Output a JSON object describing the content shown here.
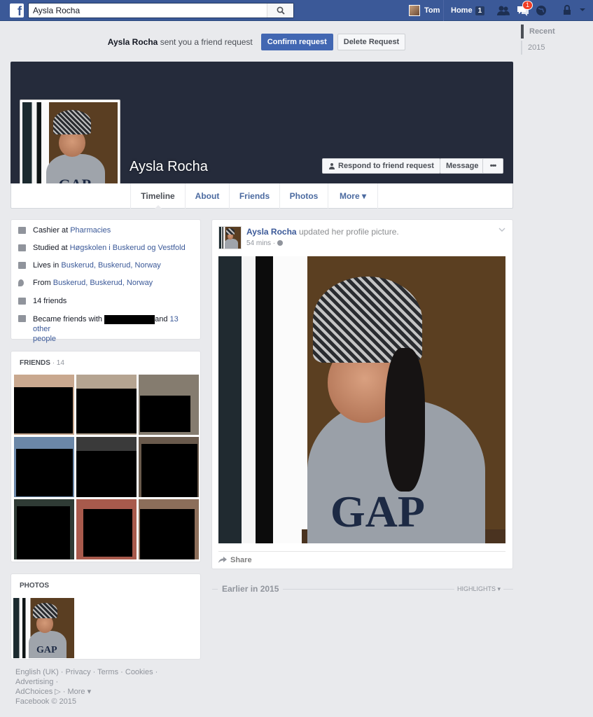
{
  "topbar": {
    "search_value": "Aysla Rocha",
    "user_name": "Tom",
    "home_label": "Home",
    "home_count": "1",
    "messages_badge": "1"
  },
  "friend_request": {
    "name": "Aysla Rocha",
    "text": "sent you a friend request",
    "confirm_label": "Confirm request",
    "delete_label": "Delete Request"
  },
  "profile": {
    "name": "Aysla Rocha",
    "respond_label": "Respond to friend request",
    "message_label": "Message",
    "more_dots": "•••",
    "gap_text": "GAP"
  },
  "tabs": [
    "Timeline",
    "About",
    "Friends",
    "Photos",
    "More ▾"
  ],
  "about": {
    "work_prefix": "Cashier at",
    "work_link": "Pharmacies",
    "study_prefix": "Studied at",
    "study_link": "Høgskolen i Buskerud og Vestfold",
    "lives_prefix": "Lives in",
    "lives_link": "Buskerud, Buskerud, Norway",
    "from_prefix": "From",
    "from_link": "Buskerud, Buskerud, Norway",
    "friends_count": "14 friends",
    "became_prefix": "Became friends with",
    "became_and": "and",
    "became_link": "13 other",
    "became_suffix": "people"
  },
  "friends_section": {
    "title": "FRIENDS",
    "count": "· 14"
  },
  "photos_section": {
    "title": "PHOTOS"
  },
  "post": {
    "author": "Aysla Rocha",
    "action": "updated her profile picture.",
    "time": "54 mins ·",
    "share_label": "Share"
  },
  "earlier": {
    "label": "Earlier in 2015",
    "highlights": "HIGHLIGHTS ▾"
  },
  "rail": {
    "items": [
      "Recent",
      "2015"
    ]
  },
  "footer": {
    "line1": "English (UK) · Privacy · Terms · Cookies · Advertising ·",
    "line2": "AdChoices ▷ · More ▾",
    "line3": "Facebook © 2015"
  },
  "colors": {
    "brand": "#3b5998",
    "cover": "#252b3b",
    "badge": "#f03d25"
  }
}
